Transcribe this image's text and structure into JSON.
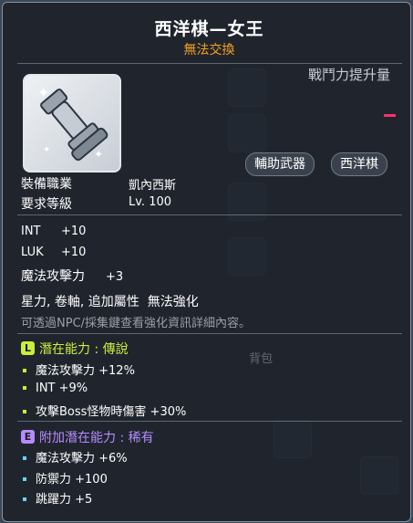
{
  "item": {
    "name": "西洋棋—女王",
    "trade_status": "無法交換",
    "power_label": "戰鬥力提升量",
    "tags": [
      "輔助武器",
      "西洋棋"
    ],
    "icon": "chess-queen-icon"
  },
  "info": [
    {
      "key": "裝備職業",
      "value": "凱內西斯"
    },
    {
      "key": "要求等級",
      "value": "Lv. 100"
    }
  ],
  "stats": [
    {
      "key": "INT",
      "value": "+10"
    },
    {
      "key": "LUK",
      "value": "+10"
    },
    {
      "key": "魔法攻擊力",
      "value": "+3"
    }
  ],
  "traits": "星力, 卷軸, 追加屬性  無法強化",
  "hint": "可透過NPC/採集鍵查看強化資訊詳細內容。",
  "potential": {
    "badge": "L",
    "label": "潛在能力 : 傳說",
    "color": "#c9ee3b",
    "lines": [
      "魔法攻擊力 +12%",
      "INT +9%",
      "攻擊Boss怪物時傷害 +30%"
    ]
  },
  "additional_potential": {
    "badge": "E",
    "label": "附加潛在能力 : 稀有",
    "color": "#b58bff",
    "lines": [
      "魔法攻擊力 +6%",
      "防禦力 +100",
      "跳躍力 +5"
    ]
  },
  "background_texts": [
    "背包"
  ]
}
